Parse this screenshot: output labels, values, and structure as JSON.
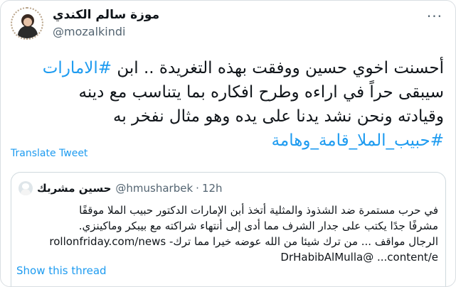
{
  "author": {
    "display_name": "موزة سالم الكندي",
    "handle": "@mozalkindi"
  },
  "menu_glyph": "···",
  "tweet": {
    "lines": [
      {
        "before": "أحسنت اخوي حسين ووفقت بهذه التغريدة .. ابن ",
        "hashtag": "#الامارات"
      },
      {
        "text": "سيبقى حراً في اراءه وطرح افكاره بما يتناسب مع دينه"
      },
      {
        "text": "وقيادته ونحن نشد يدنا على يده وهو مثال نفخر به"
      },
      {
        "hashtag": "#حبيب_الملا_قامة_وهامة"
      }
    ]
  },
  "translate_label": "Translate Tweet",
  "quote": {
    "display_name": "حسين مشربك",
    "handle": "@hmusharbek",
    "separator": "·",
    "time": "12h",
    "lines": [
      "في حرب مستمرة ضد الشذوذ والمثلية أتخذ أبن الإمارات الدكتور حبيب الملا موقفًا",
      "مشرفًا جدًا يكتب على جدار الشرف مما أدى إلى أنتهاء شراكته مع بيبكر وماكينزي.",
      "الرجال مواقف ... من ترك شيئا من الله عوضه خيرا مما ترك- rollonfriday.com/news",
      "content/e...‏ @DrHabibAlMulla"
    ]
  },
  "show_thread_label": "Show this thread",
  "colors": {
    "link": "#1d9bf0",
    "secondary": "#536471",
    "border": "#cfd9de"
  }
}
